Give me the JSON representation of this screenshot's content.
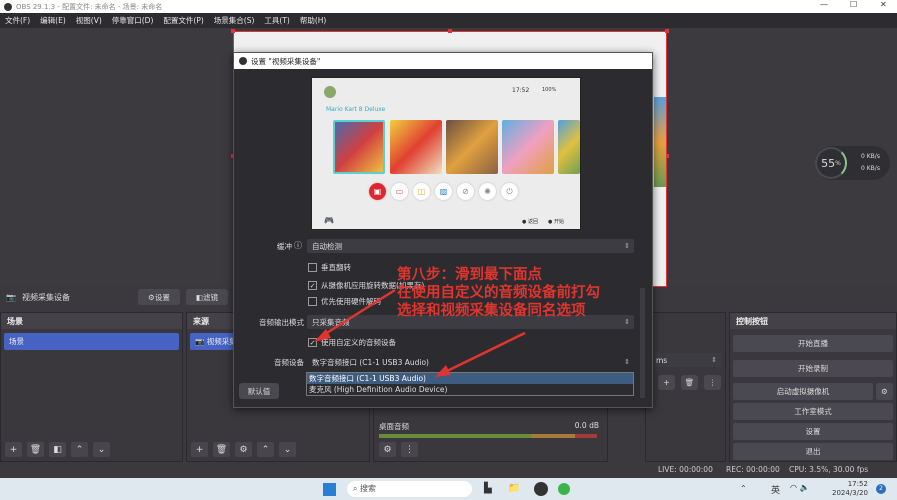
{
  "window": {
    "title": "OBS 29.1.3 - 配置文件: 未命名 - 场景: 未命名",
    "controls": [
      "—",
      "☐",
      "✕"
    ]
  },
  "menu": [
    "文件(F)",
    "编辑(E)",
    "视图(V)",
    "停靠窗口(D)",
    "配置文件(P)",
    "场景集合(S)",
    "工具(T)",
    "帮助(H)"
  ],
  "colors": {
    "accent": "#4663c3",
    "annotation": "#e0352e",
    "selection_box": "#e0343a"
  },
  "gauge": {
    "percent": "55",
    "unit": "%",
    "up": "0",
    "down": "0",
    "rate_unit": "KB/s"
  },
  "dialog": {
    "title": "设置 \"视频采集设备\"",
    "preview": {
      "time": "17:52",
      "battery": "100%",
      "game_title": "Mario Kart 8 Deluxe",
      "footer_back": "返回",
      "footer_start": "开始"
    },
    "buffer_label": "缓冲",
    "buffer_value": "自动检测",
    "flip_vertical": {
      "label": "垂直翻转",
      "checked": false
    },
    "rotation": {
      "label": "从摄像机应用旋转数据(如果有)",
      "checked": true
    },
    "hw_decode": {
      "label": "优先使用硬件解码",
      "checked": false
    },
    "audio_mode_label": "音频输出模式",
    "audio_mode_value": "只采集音频",
    "custom_audio": {
      "label": "使用自定义的音频设备",
      "checked": true
    },
    "audio_device_label": "音频设备",
    "audio_device_value": "数字音频接口 (C1-1 USB3 Audio)",
    "audio_device_options": [
      "数字音频接口 (C1-1 USB3 Audio)",
      "麦克风 (High Definition Audio Device)"
    ],
    "defaults_button": "默认值"
  },
  "annotation": [
    "第八步：滑到最下面点",
    "在使用自定义的音频设备前打勾",
    "选择和视频采集设备同名选项"
  ],
  "source_toolbar": {
    "source_name": "视频采集设备",
    "settings": "设置",
    "filters": "滤镜",
    "deactivate": "取"
  },
  "scenes": {
    "title": "场景",
    "items": [
      "场景"
    ]
  },
  "sources": {
    "title": "来源",
    "items": [
      "视频采集设备"
    ]
  },
  "mixer": {
    "channel": "桌面音频",
    "level": "0.0 dB"
  },
  "transitions": {
    "duration_unit": "ms"
  },
  "controls": {
    "title": "控制按钮",
    "buttons": [
      "开始直播",
      "开始录制",
      "启动虚拟摄像机",
      "工作室模式",
      "设置",
      "退出"
    ]
  },
  "status": {
    "live": "LIVE: 00:00:00",
    "rec": "REC: 00:00:00",
    "cpu": "CPU: 3.5%, 30.00 fps"
  },
  "taskbar": {
    "search_placeholder": "搜索",
    "ime": "英",
    "time": "17:52",
    "date": "2024/3/20",
    "notif": "2"
  }
}
